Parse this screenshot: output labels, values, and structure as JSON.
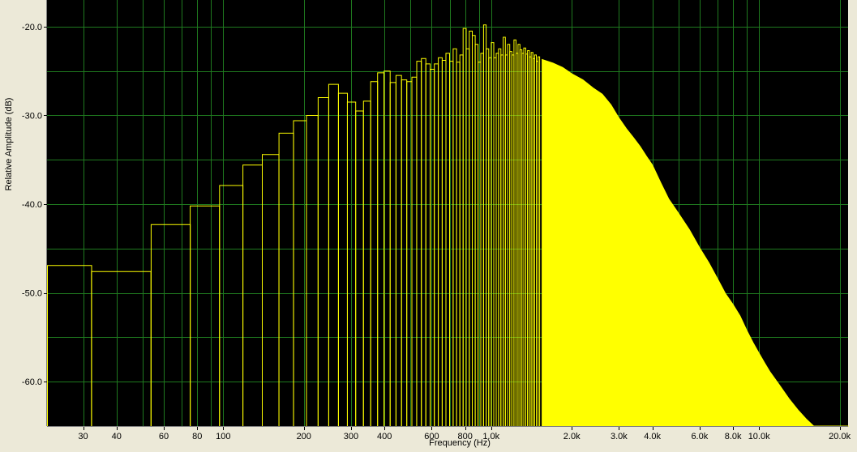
{
  "chart_data": {
    "type": "bar",
    "title": "",
    "xlabel": "Frequency (Hz)",
    "ylabel": "Relative Amplitude (dB)",
    "x_scale": "log",
    "xlim": [
      22,
      21500
    ],
    "ylim": [
      -65,
      -17
    ],
    "grid": true,
    "x_ticks": [
      {
        "value": 30,
        "label": "30"
      },
      {
        "value": 40,
        "label": "40"
      },
      {
        "value": 60,
        "label": "60"
      },
      {
        "value": 80,
        "label": "80"
      },
      {
        "value": 100,
        "label": "100"
      },
      {
        "value": 200,
        "label": "200"
      },
      {
        "value": 300,
        "label": "300"
      },
      {
        "value": 400,
        "label": "400"
      },
      {
        "value": 600,
        "label": "600"
      },
      {
        "value": 800,
        "label": "800"
      },
      {
        "value": 1000,
        "label": "1.0k"
      },
      {
        "value": 2000,
        "label": "2.0k"
      },
      {
        "value": 3000,
        "label": "3.0k"
      },
      {
        "value": 4000,
        "label": "4.0k"
      },
      {
        "value": 6000,
        "label": "6.0k"
      },
      {
        "value": 8000,
        "label": "8.0k"
      },
      {
        "value": 10000,
        "label": "10.0k"
      },
      {
        "value": 20000,
        "label": "20.0k"
      }
    ],
    "y_ticks": [
      {
        "value": -20,
        "label": "-20.0"
      },
      {
        "value": -30,
        "label": "-30.0"
      },
      {
        "value": -40,
        "label": "-40.0"
      },
      {
        "value": -50,
        "label": "-50.0"
      },
      {
        "value": -60,
        "label": "-60.0"
      }
    ],
    "bin_width_hz": 21.53,
    "series": [
      {
        "color": "#ffff00",
        "points": [
          [
            21.5,
            -46.9
          ],
          [
            43,
            -47.6
          ],
          [
            64.6,
            -42.3
          ],
          [
            86.1,
            -40.2
          ],
          [
            107.7,
            -37.9
          ],
          [
            129.2,
            -35.6
          ],
          [
            150.7,
            -34.4
          ],
          [
            172.3,
            -32.0
          ],
          [
            193.8,
            -30.6
          ],
          [
            215.3,
            -30.0
          ],
          [
            236.9,
            -28.0
          ],
          [
            258.4,
            -26.5
          ],
          [
            280,
            -27.5
          ],
          [
            301.5,
            -28.5
          ],
          [
            323,
            -29.5
          ],
          [
            344.6,
            -28.4
          ],
          [
            366.1,
            -26.2
          ],
          [
            387.6,
            -25.2
          ],
          [
            409.2,
            -25.0
          ],
          [
            430.7,
            -26.3
          ],
          [
            452.2,
            -25.5
          ],
          [
            473.8,
            -26.0
          ],
          [
            495.3,
            -26.2
          ],
          [
            516.8,
            -25.7
          ],
          [
            538.4,
            -23.9
          ],
          [
            559.9,
            -23.6
          ],
          [
            581.5,
            -24.2
          ],
          [
            603,
            -24.8
          ],
          [
            624.5,
            -24.2
          ],
          [
            646,
            -23.5
          ],
          [
            667.6,
            -23.8
          ],
          [
            689.1,
            -23.0
          ],
          [
            710.7,
            -23.9
          ],
          [
            732.2,
            -22.5
          ],
          [
            753.7,
            -24.0
          ],
          [
            775.3,
            -23.2
          ],
          [
            796.8,
            -20.2
          ],
          [
            818.3,
            -22.5
          ],
          [
            839.9,
            -20.5
          ],
          [
            861.4,
            -21.0
          ],
          [
            883,
            -22.0
          ],
          [
            904.5,
            -24.0
          ],
          [
            926,
            -23.0
          ],
          [
            947.6,
            -19.8
          ],
          [
            969.1,
            -22.5
          ],
          [
            990.6,
            -23.5
          ],
          [
            1012.2,
            -21.8
          ],
          [
            1033.7,
            -23.5
          ],
          [
            1055.2,
            -23.0
          ],
          [
            1076.8,
            -22.5
          ],
          [
            1098.3,
            -23.2
          ],
          [
            1119.8,
            -21.2
          ],
          [
            1141.4,
            -23.2
          ],
          [
            1162.9,
            -22.0
          ],
          [
            1184.5,
            -22.8
          ],
          [
            1206,
            -23.2
          ],
          [
            1227.5,
            -21.5
          ],
          [
            1249,
            -23.0
          ],
          [
            1270.6,
            -22.0
          ],
          [
            1292.1,
            -22.6
          ],
          [
            1313.7,
            -23.0
          ],
          [
            1335.2,
            -22.4
          ],
          [
            1356.7,
            -23.1
          ],
          [
            1378.3,
            -22.7
          ],
          [
            1399.8,
            -23.4
          ],
          [
            1421.3,
            -22.9
          ],
          [
            1442.9,
            -23.6
          ],
          [
            1464.4,
            -23.2
          ],
          [
            1485.9,
            -23.9
          ],
          [
            1507.5,
            -23.4
          ]
        ],
        "envelope": [
          [
            1550,
            -23.7
          ],
          [
            1700,
            -24.1
          ],
          [
            1850,
            -24.6
          ],
          [
            2000,
            -25.3
          ],
          [
            2200,
            -26.0
          ],
          [
            2400,
            -26.9
          ],
          [
            2600,
            -27.6
          ],
          [
            2800,
            -28.8
          ],
          [
            3000,
            -30.3
          ],
          [
            3200,
            -31.5
          ],
          [
            3400,
            -32.5
          ],
          [
            3600,
            -33.5
          ],
          [
            3800,
            -34.6
          ],
          [
            4000,
            -35.6
          ],
          [
            4300,
            -37.6
          ],
          [
            4600,
            -39.4
          ],
          [
            5000,
            -41.0
          ],
          [
            5500,
            -42.9
          ],
          [
            6000,
            -44.9
          ],
          [
            6500,
            -46.6
          ],
          [
            7000,
            -48.4
          ],
          [
            7500,
            -50.1
          ],
          [
            8000,
            -51.3
          ],
          [
            8500,
            -52.6
          ],
          [
            9000,
            -54.2
          ],
          [
            9500,
            -55.6
          ],
          [
            10000,
            -56.8
          ],
          [
            10500,
            -57.9
          ],
          [
            11000,
            -58.9
          ],
          [
            12000,
            -60.5
          ],
          [
            13000,
            -62.0
          ],
          [
            14000,
            -63.2
          ],
          [
            15000,
            -64.2
          ],
          [
            16000,
            -65.0
          ]
        ]
      }
    ]
  }
}
